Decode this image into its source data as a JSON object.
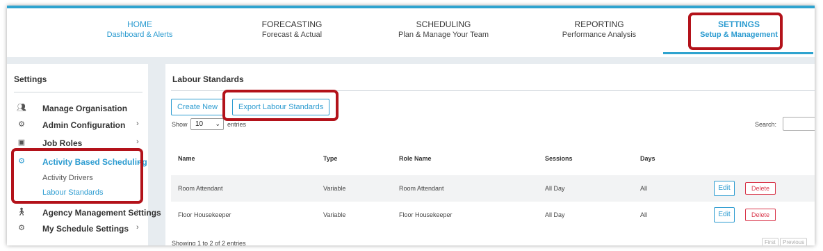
{
  "nav": {
    "items": [
      {
        "title": "HOME",
        "subtitle": "Dashboard & Alerts"
      },
      {
        "title": "FORECASTING",
        "subtitle": "Forecast & Actual"
      },
      {
        "title": "SCHEDULING",
        "subtitle": "Plan & Manage Your Team"
      },
      {
        "title": "REPORTING",
        "subtitle": "Performance Analysis"
      },
      {
        "title": "SETTINGS",
        "subtitle": "Setup & Management"
      }
    ],
    "active": "SETTINGS"
  },
  "sidebar": {
    "title": "Settings",
    "items": [
      {
        "label": "Manage Organisation",
        "icon": "users-icon"
      },
      {
        "label": "Admin Configuration",
        "icon": "gear-icon"
      },
      {
        "label": "Job Roles",
        "icon": "id-badge-icon"
      },
      {
        "label": "Activity Based Scheduling",
        "icon": "gear-icon"
      },
      {
        "label": "Agency Management Settings",
        "icon": "walking-person-icon"
      },
      {
        "label": "My Schedule Settings",
        "icon": "gear-icon"
      }
    ],
    "subitems": [
      {
        "label": "Activity Drivers"
      },
      {
        "label": "Labour Standards"
      }
    ]
  },
  "main": {
    "title": "Labour Standards",
    "create_label": "Create New",
    "export_label": "Export Labour Standards",
    "show_label": "Show",
    "page_size": "10",
    "entries_label": "entries",
    "search_label": "Search:",
    "columns": [
      "Name",
      "Type",
      "Role Name",
      "Sessions",
      "Days"
    ],
    "rows": [
      {
        "name": "Room Attendant",
        "type": "Variable",
        "role": "Room Attendant",
        "sessions": "All Day",
        "days": "All"
      },
      {
        "name": "Floor Housekeeper",
        "type": "Variable",
        "role": "Floor Housekeeper",
        "sessions": "All Day",
        "days": "All"
      }
    ],
    "edit_label": "Edit",
    "delete_label": "Delete",
    "showing_text": "Showing 1 to 2 of 2 entries",
    "pagination": {
      "first": "First",
      "previous": "Previous"
    }
  },
  "colors": {
    "accent": "#2b9bd0",
    "highlight": "#b3121a",
    "danger": "#d9374b"
  }
}
